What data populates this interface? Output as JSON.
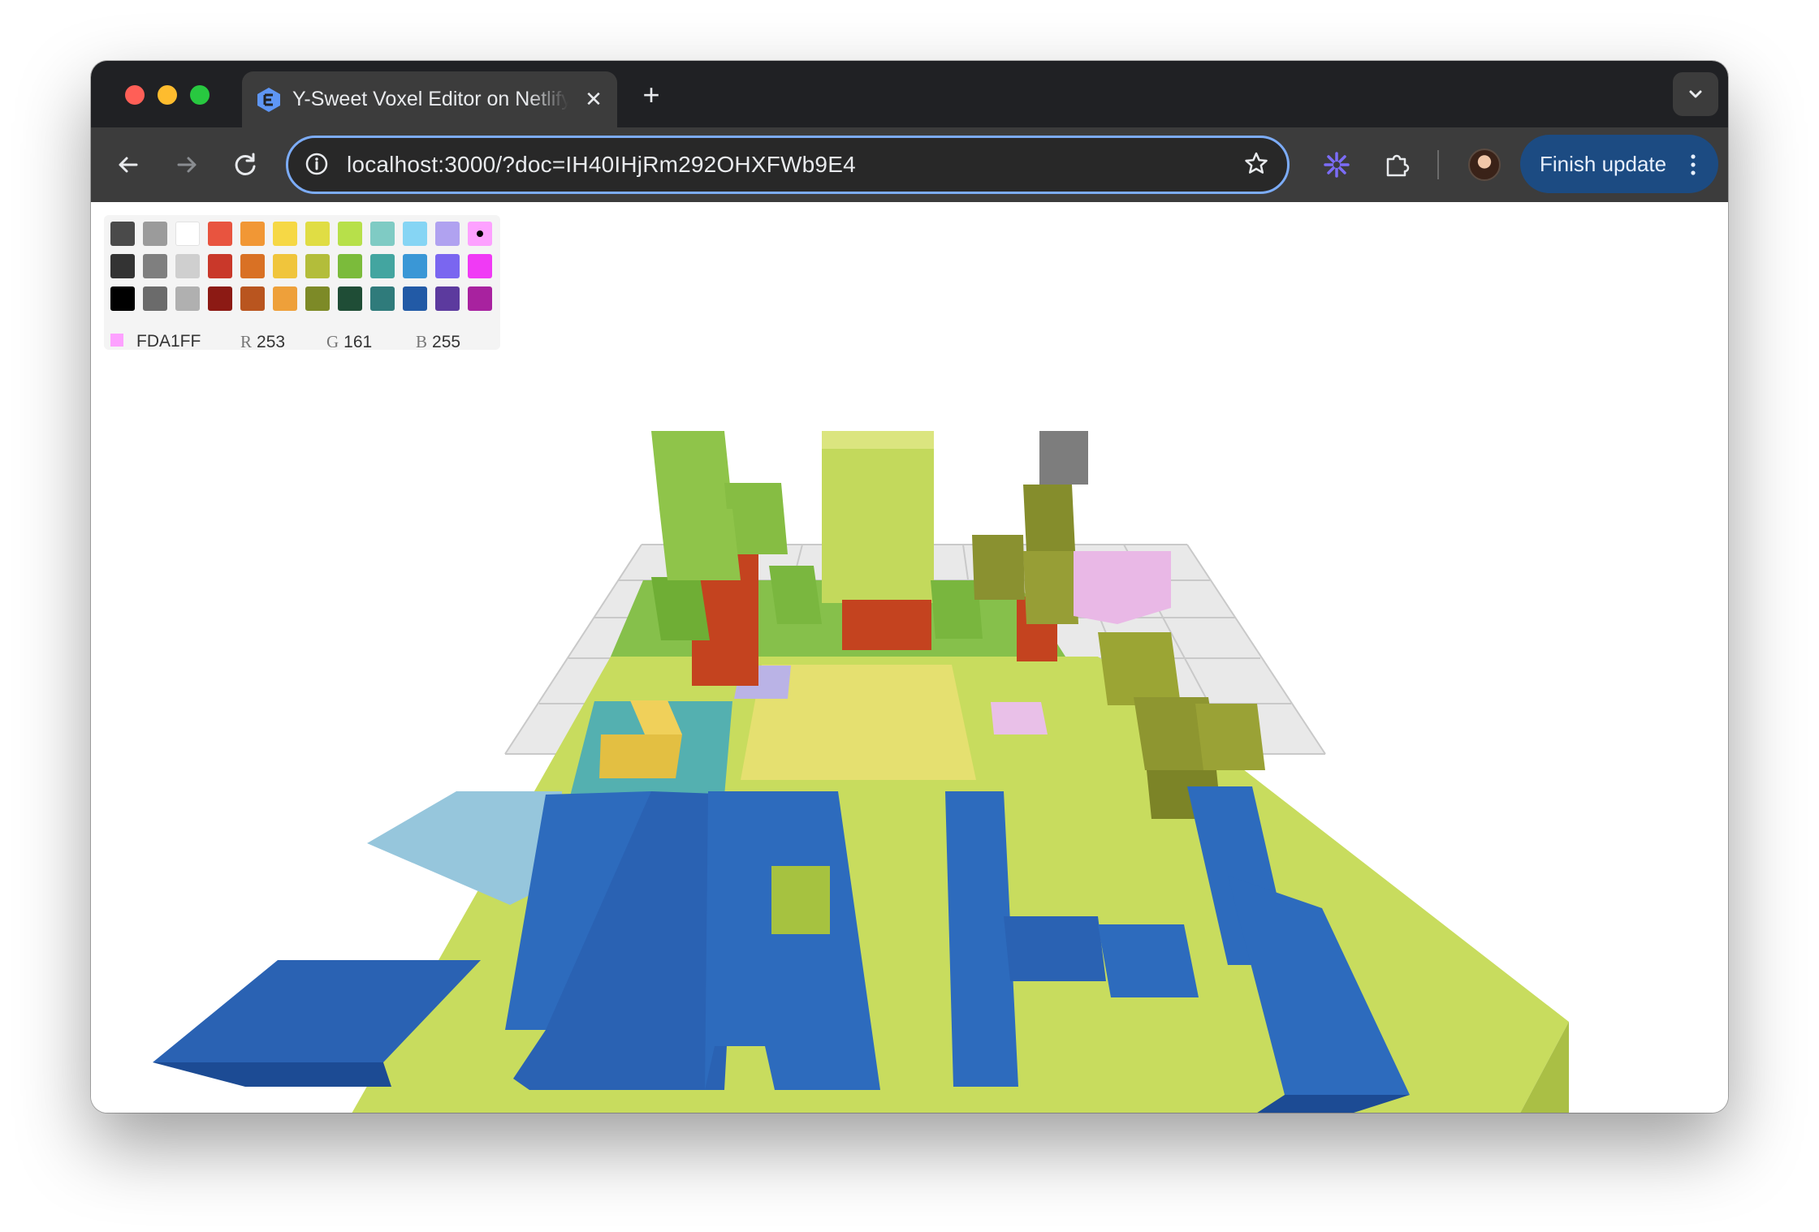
{
  "window": {
    "tab": {
      "title": "Y-Sweet Voxel Editor on Netlify",
      "close_label": "✕"
    },
    "new_tab_label": "+"
  },
  "toolbar": {
    "url": "localhost:3000/?doc=IH40IHjRm292OHXFWb9E4",
    "update_label": "Finish update"
  },
  "palette": {
    "colors": [
      [
        "#4a4a4a",
        "#9b9b9b",
        "#ffffff",
        "#e8543f",
        "#f19735",
        "#f6d845",
        "#e0dd44",
        "#b7e04a",
        "#7fcbc4",
        "#86d5f4",
        "#b0a2f0",
        "#fda1ff"
      ],
      [
        "#333333",
        "#7f7f7f",
        "#cfcfcf",
        "#c9382a",
        "#d97124",
        "#f0c53c",
        "#b3bd3a",
        "#7bbb3b",
        "#43a5a0",
        "#3a97d6",
        "#7a66f0",
        "#f03af5"
      ],
      [
        "#000000",
        "#6b6b6b",
        "#b0b0b0",
        "#8c1a14",
        "#b9551f",
        "#eea03a",
        "#7d8a27",
        "#1f4d36",
        "#2f7b7b",
        "#225aa6",
        "#5c3a9e",
        "#a8229f"
      ]
    ],
    "selected": {
      "row": 0,
      "col": 11
    },
    "current": {
      "hex": "FDA1FF",
      "r_label": "R",
      "r": "253",
      "g_label": "G",
      "g": "161",
      "b_label": "B",
      "b": "255",
      "color": "#fda1ff"
    }
  },
  "icons": {
    "back": "arrow-left-icon",
    "forward": "arrow-right-icon",
    "reload": "reload-icon",
    "info": "info-icon",
    "star": "star-icon",
    "extension": "puzzle-icon",
    "menu": "kebab-icon"
  },
  "colors": {
    "tab_bar": "#202124",
    "toolbar": "#3c3c3c",
    "omnibox_border": "#7cacf8",
    "update_button": "#1c4b82"
  }
}
